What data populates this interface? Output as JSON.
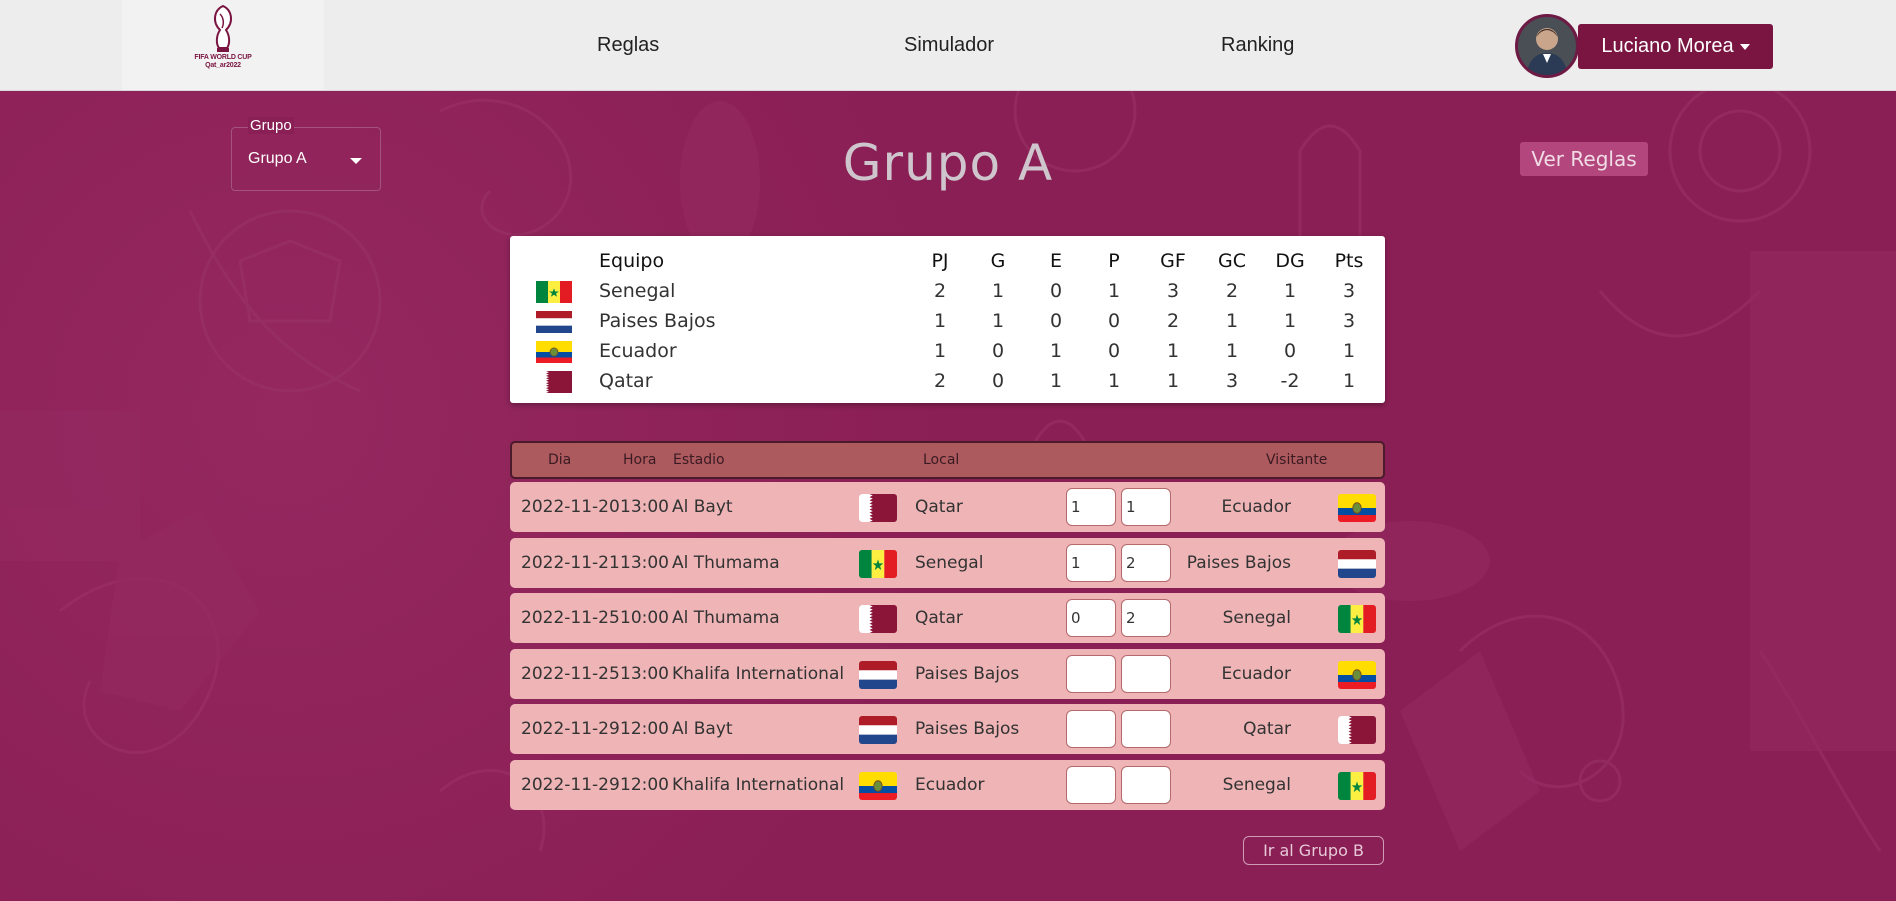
{
  "brand": {
    "logo_line1": "FIFA WORLD CUP",
    "logo_line2": "Qat_ar2022"
  },
  "nav": {
    "links": [
      "Reglas",
      "Simulador",
      "Ranking"
    ],
    "user_name": "Luciano Morea"
  },
  "group_select": {
    "label": "Grupo",
    "value": "Grupo A"
  },
  "page_title": "Grupo A",
  "rules_button": "Ver Reglas",
  "standings": {
    "headers": [
      "Equipo",
      "PJ",
      "G",
      "E",
      "P",
      "GF",
      "GC",
      "DG",
      "Pts"
    ],
    "rows": [
      {
        "team": "Senegal",
        "flag": "senegal",
        "pj": "2",
        "g": "1",
        "e": "0",
        "p": "1",
        "gf": "3",
        "gc": "2",
        "dg": "1",
        "pts": "3"
      },
      {
        "team": "Paises Bajos",
        "flag": "netherlands",
        "pj": "1",
        "g": "1",
        "e": "0",
        "p": "0",
        "gf": "2",
        "gc": "1",
        "dg": "1",
        "pts": "3"
      },
      {
        "team": "Ecuador",
        "flag": "ecuador",
        "pj": "1",
        "g": "0",
        "e": "1",
        "p": "0",
        "gf": "1",
        "gc": "1",
        "dg": "0",
        "pts": "1"
      },
      {
        "team": "Qatar",
        "flag": "qatar",
        "pj": "2",
        "g": "0",
        "e": "1",
        "p": "1",
        "gf": "1",
        "gc": "3",
        "dg": "-2",
        "pts": "1"
      }
    ]
  },
  "matches": {
    "headers": {
      "dia": "Dia",
      "hora": "Hora",
      "estadio": "Estadio",
      "local": "Local",
      "visitante": "Visitante"
    },
    "rows": [
      {
        "dia": "2022-11-20",
        "hora": "13:00",
        "estadio": "Al Bayt",
        "local": "Qatar",
        "local_flag": "qatar",
        "score_local": "1",
        "score_visit": "1",
        "visitante": "Ecuador",
        "visit_flag": "ecuador"
      },
      {
        "dia": "2022-11-21",
        "hora": "13:00",
        "estadio": "Al Thumama",
        "local": "Senegal",
        "local_flag": "senegal",
        "score_local": "1",
        "score_visit": "2",
        "visitante": "Paises Bajos",
        "visit_flag": "netherlands"
      },
      {
        "dia": "2022-11-25",
        "hora": "10:00",
        "estadio": "Al Thumama",
        "local": "Qatar",
        "local_flag": "qatar",
        "score_local": "0",
        "score_visit": "2",
        "visitante": "Senegal",
        "visit_flag": "senegal"
      },
      {
        "dia": "2022-11-25",
        "hora": "13:00",
        "estadio": "Khalifa International",
        "local": "Paises Bajos",
        "local_flag": "netherlands",
        "score_local": "",
        "score_visit": "",
        "visitante": "Ecuador",
        "visit_flag": "ecuador"
      },
      {
        "dia": "2022-11-29",
        "hora": "12:00",
        "estadio": "Al Bayt",
        "local": "Paises Bajos",
        "local_flag": "netherlands",
        "score_local": "",
        "score_visit": "",
        "visitante": "Qatar",
        "visit_flag": "qatar"
      },
      {
        "dia": "2022-11-29",
        "hora": "12:00",
        "estadio": "Khalifa International",
        "local": "Ecuador",
        "local_flag": "ecuador",
        "score_local": "",
        "score_visit": "",
        "visitante": "Senegal",
        "visit_flag": "senegal"
      }
    ]
  },
  "next_button": "Ir al Grupo B",
  "colors": {
    "primary": "#7a1541",
    "background": "#8a1f55",
    "row_bg": "#eeb4b6",
    "header_bg": "#ad5a5e",
    "rules_btn": "#b3477d"
  }
}
